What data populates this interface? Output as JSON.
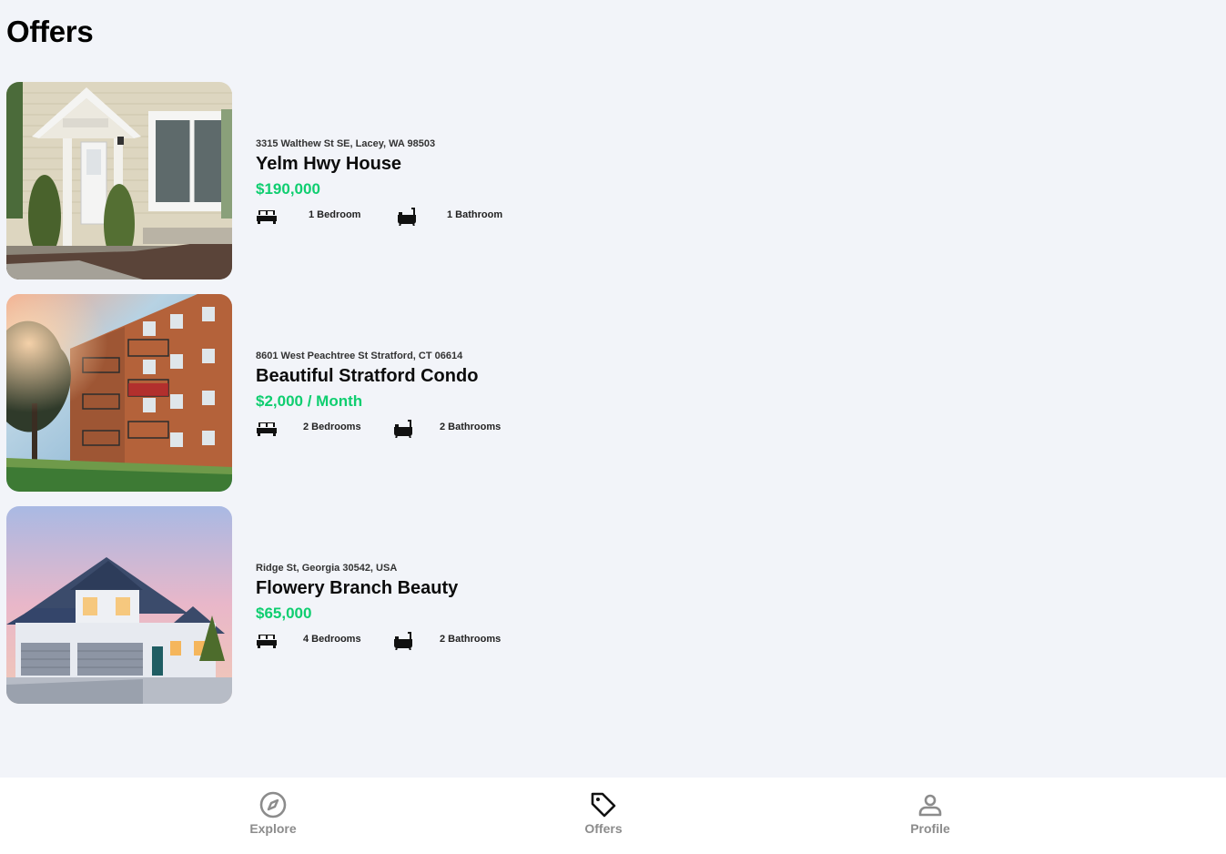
{
  "page": {
    "title": "Offers"
  },
  "listings": [
    {
      "address": "3315 Walthew St SE, Lacey, WA 98503",
      "name": "Yelm Hwy House",
      "price": "$190,000",
      "bedrooms": "1 Bedroom",
      "bathrooms": "1 Bathroom",
      "photo": "townhouse-photo"
    },
    {
      "address": "8601 West Peachtree St Stratford, CT 06614",
      "name": "Beautiful Stratford Condo",
      "price": "$2,000 / Month",
      "bedrooms": "2 Bedrooms",
      "bathrooms": "2 Bathrooms",
      "photo": "apartment-building-photo"
    },
    {
      "address": "Ridge St, Georgia 30542, USA",
      "name": "Flowery Branch Beauty",
      "price": "$65,000",
      "bedrooms": "4 Bedrooms",
      "bathrooms": "2 Bathrooms",
      "photo": "suburban-house-photo"
    }
  ],
  "icons": {
    "bed": "bed-icon",
    "bath": "bathtub-icon"
  },
  "colors": {
    "price": "#0fce70",
    "background": "#f2f4f9",
    "tab_label": "#8c8c8c"
  },
  "tabbar": {
    "tabs": [
      {
        "label": "Explore",
        "icon": "compass-icon"
      },
      {
        "label": "Offers",
        "icon": "tag-icon",
        "active": true
      },
      {
        "label": "Profile",
        "icon": "person-icon"
      }
    ]
  }
}
